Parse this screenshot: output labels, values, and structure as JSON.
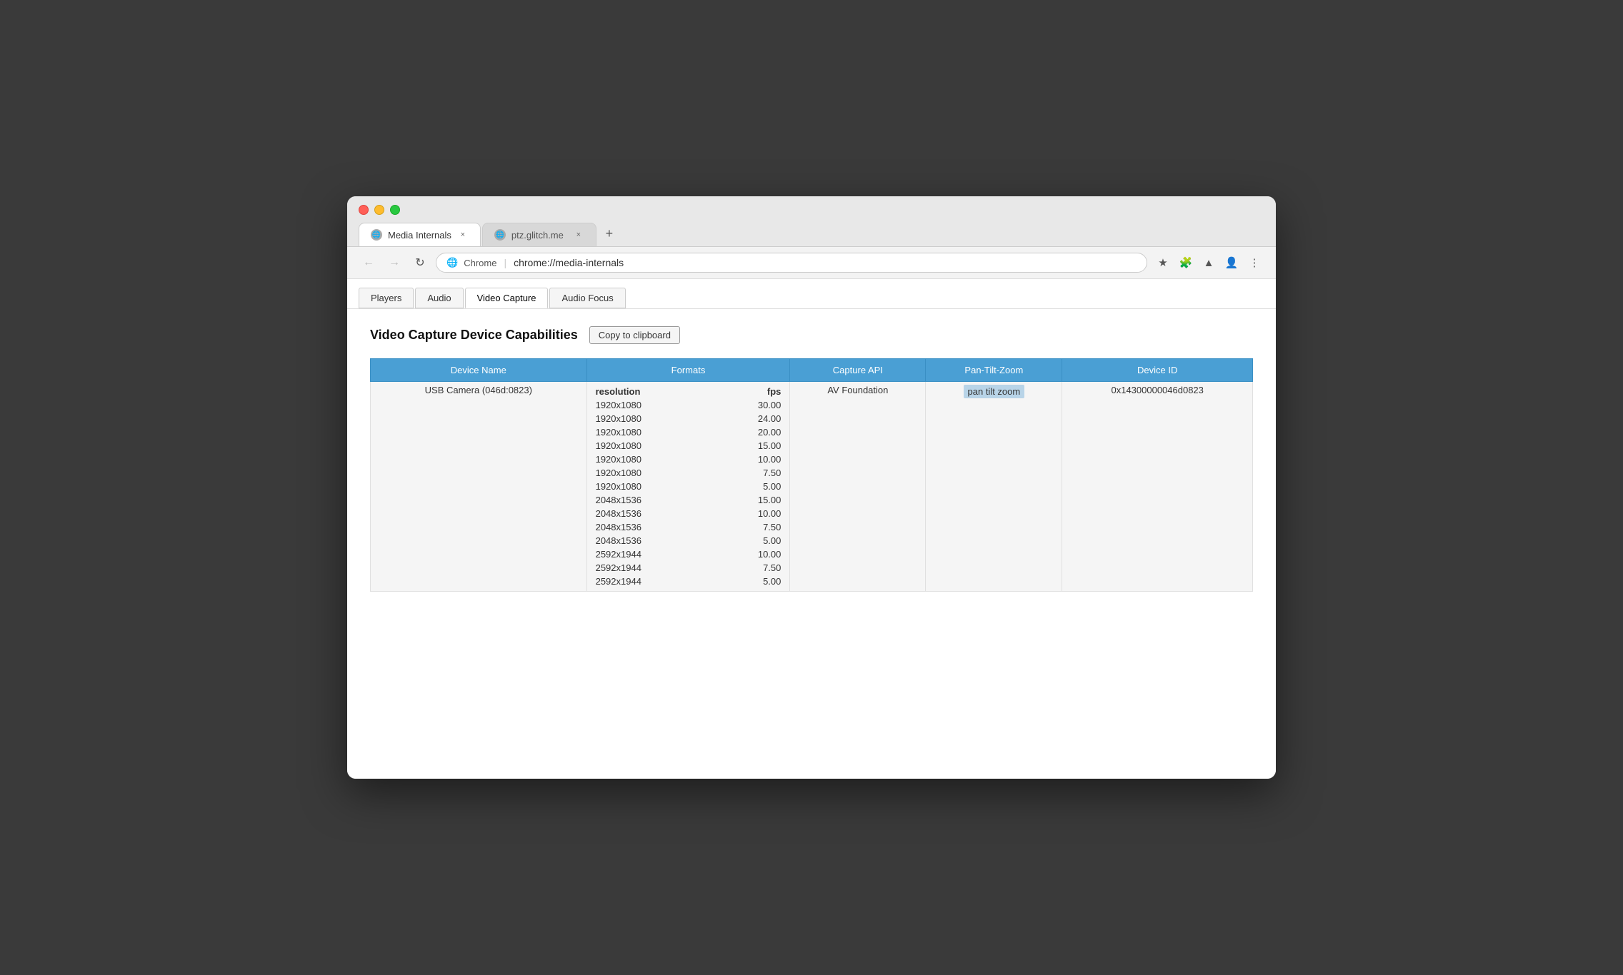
{
  "browser": {
    "traffic_lights": [
      "red",
      "yellow",
      "green"
    ],
    "tabs": [
      {
        "label": "Media Internals",
        "active": true,
        "icon": "globe",
        "close_label": "×"
      },
      {
        "label": "ptz.glitch.me",
        "active": false,
        "icon": "globe",
        "close_label": "×"
      }
    ],
    "new_tab_label": "+",
    "address_bar": {
      "protocol_label": "Chrome",
      "separator": "|",
      "url": "chrome://media-internals"
    },
    "nav": {
      "back": "←",
      "forward": "→",
      "reload": "↻"
    },
    "toolbar_icons": [
      "★",
      "🧩",
      "▲",
      "👤",
      "⋮"
    ]
  },
  "page": {
    "nav_tabs": [
      "Players",
      "Audio",
      "Video Capture",
      "Audio Focus"
    ],
    "active_tab": "Video Capture",
    "section_title": "Video Capture Device Capabilities",
    "copy_button_label": "Copy to clipboard",
    "table": {
      "headers": [
        "Device Name",
        "Formats",
        "Capture API",
        "Pan-Tilt-Zoom",
        "Device ID"
      ],
      "formats_sub_headers": [
        "resolution",
        "fps"
      ],
      "rows": [
        {
          "device_name": "USB Camera (046d:0823)",
          "formats": [
            {
              "resolution": "1920x1080",
              "fps": "30.00"
            },
            {
              "resolution": "1920x1080",
              "fps": "24.00"
            },
            {
              "resolution": "1920x1080",
              "fps": "20.00"
            },
            {
              "resolution": "1920x1080",
              "fps": "15.00"
            },
            {
              "resolution": "1920x1080",
              "fps": "10.00"
            },
            {
              "resolution": "1920x1080",
              "fps": "7.50"
            },
            {
              "resolution": "1920x1080",
              "fps": "5.00"
            },
            {
              "resolution": "2048x1536",
              "fps": "15.00"
            },
            {
              "resolution": "2048x1536",
              "fps": "10.00"
            },
            {
              "resolution": "2048x1536",
              "fps": "7.50"
            },
            {
              "resolution": "2048x1536",
              "fps": "5.00"
            },
            {
              "resolution": "2592x1944",
              "fps": "10.00"
            },
            {
              "resolution": "2592x1944",
              "fps": "7.50"
            },
            {
              "resolution": "2592x1944",
              "fps": "5.00"
            }
          ],
          "capture_api": "AV Foundation",
          "ptz": "pan tilt zoom",
          "device_id": "0x14300000046d0823"
        }
      ]
    }
  }
}
